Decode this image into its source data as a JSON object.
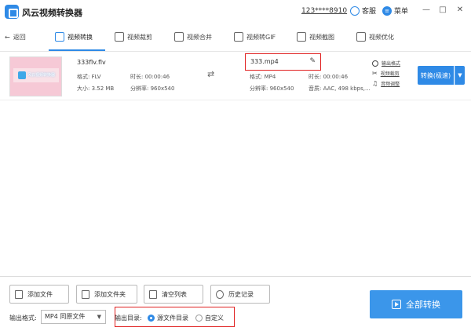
{
  "window": {
    "title": "风云视频转换器",
    "account": "123****8910",
    "support_label": "客服",
    "menu_label": "菜单",
    "minimize": "—",
    "maximize": "□",
    "close": "✕"
  },
  "toolbar": {
    "back_label": "返回",
    "tabs": [
      {
        "label": "视频转换",
        "active": true
      },
      {
        "label": "视频裁剪"
      },
      {
        "label": "视频合并"
      },
      {
        "label": "视频转GIF"
      },
      {
        "label": "视频截图"
      },
      {
        "label": "视频优化"
      }
    ]
  },
  "file": {
    "source": {
      "name": "333flv.flv",
      "format": "格式: FLV",
      "size": "大小: 3.52 MB",
      "duration": "时长: 00:00:46",
      "resolution": "分辨率: 960x540"
    },
    "thumbnail_text": "风云视频转换器",
    "output": {
      "name": "333.mp4",
      "format": "格式: MP4",
      "resolution": "分辨率: 960x540",
      "duration": "时长: 00:00:46",
      "audio": "音质: AAC, 498 kbps,..."
    },
    "side_tools": [
      "输出格式",
      "视频裁剪",
      "音频调整"
    ],
    "convert_button": "转换(极速)"
  },
  "bottom": {
    "buttons": [
      "添加文件",
      "添加文件夹",
      "清空列表",
      "历史记录"
    ],
    "output_format_label": "输出格式:",
    "output_format_value": "MP4 同原文件",
    "output_dir_label": "输出目录:",
    "output_dir_options": [
      "源文件目录",
      "自定义"
    ],
    "output_dir_selected": "源文件目录",
    "convert_all": "全部转换"
  },
  "colors": {
    "accent": "#2f8ae6",
    "highlight_box": "#e02020"
  }
}
